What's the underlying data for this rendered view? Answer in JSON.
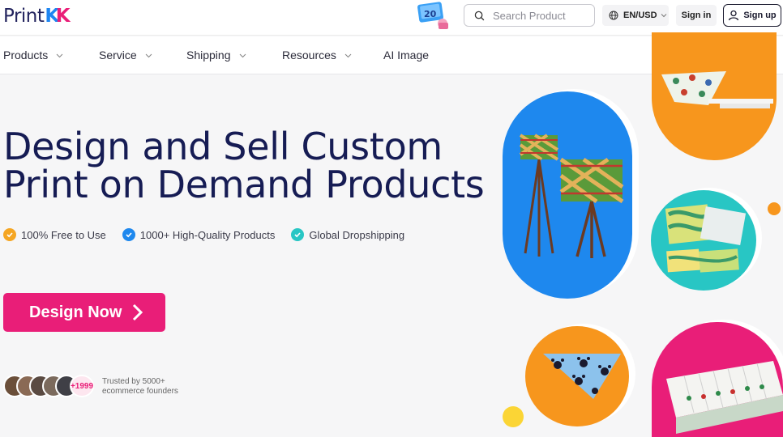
{
  "header": {
    "logo_text": "Print",
    "logo_k1": "K",
    "logo_k2": "K",
    "promo_badge": "20",
    "search_placeholder": "Search Product",
    "lang_label": "EN/USD",
    "signin_label": "Sign in",
    "signup_label": "Sign up"
  },
  "nav": {
    "items": [
      {
        "label": "Products"
      },
      {
        "label": "Service"
      },
      {
        "label": "Shipping"
      },
      {
        "label": "Resources"
      },
      {
        "label": "AI Image"
      }
    ]
  },
  "hero": {
    "title_line1": "Design and Sell Custom",
    "title_line2": "Print on Demand Products",
    "features": [
      {
        "label": "100% Free to Use",
        "color": "#f5a623"
      },
      {
        "label": "1000+ High-Quality Products",
        "color": "#1e88ee"
      },
      {
        "label": "Global Dropshipping",
        "color": "#28c6c4"
      }
    ],
    "cta_label": "Design Now",
    "avatar_count": "+1999",
    "trusted_line1": "Trusted by 5000+",
    "trusted_line2": "ecommerce founders"
  },
  "colors": {
    "brand_pink": "#e91e78",
    "brand_blue": "#1e88ee",
    "navy": "#161c54",
    "orange": "#f7961d",
    "teal": "#28c6c4",
    "yellow": "#fbd535"
  }
}
